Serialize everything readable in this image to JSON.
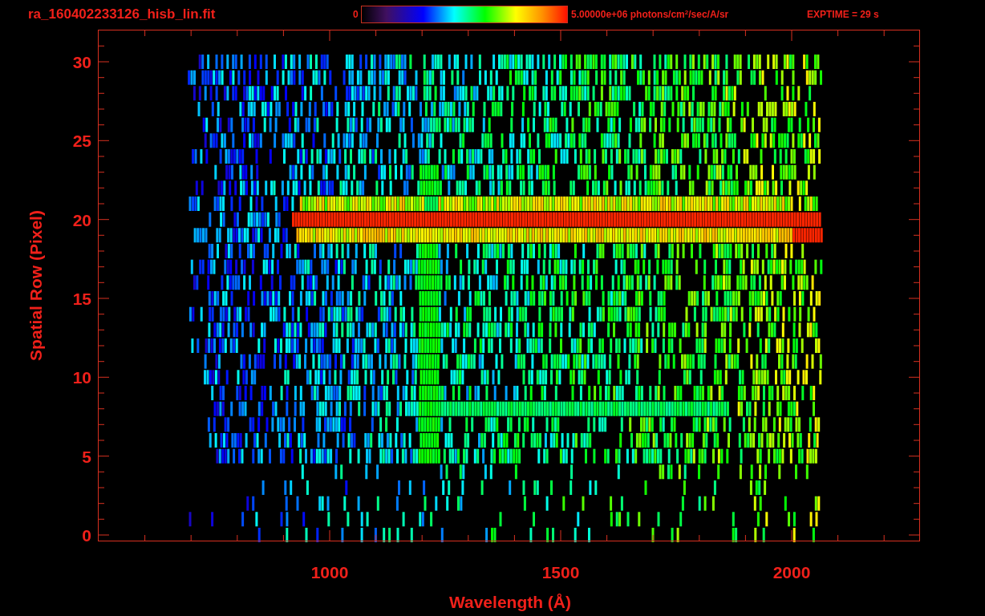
{
  "header": {
    "title": "ra_160402233126_hisb_lin.fit",
    "colorbar": {
      "min_label": "0",
      "max_label": "5.00000e+06 photons/cm$^{2}$/sec/A/sr"
    },
    "exposure": "EXPTIME = 29 s"
  },
  "plot": {
    "xlabel": "Wavelength (Å)",
    "ylabel": "Spatial Row (Pixel)",
    "xtick_labels": [
      "1000",
      "1500",
      "2000"
    ],
    "ytick_labels": [
      "30",
      "25",
      "20",
      "15",
      "10",
      "5",
      "0"
    ]
  }
}
